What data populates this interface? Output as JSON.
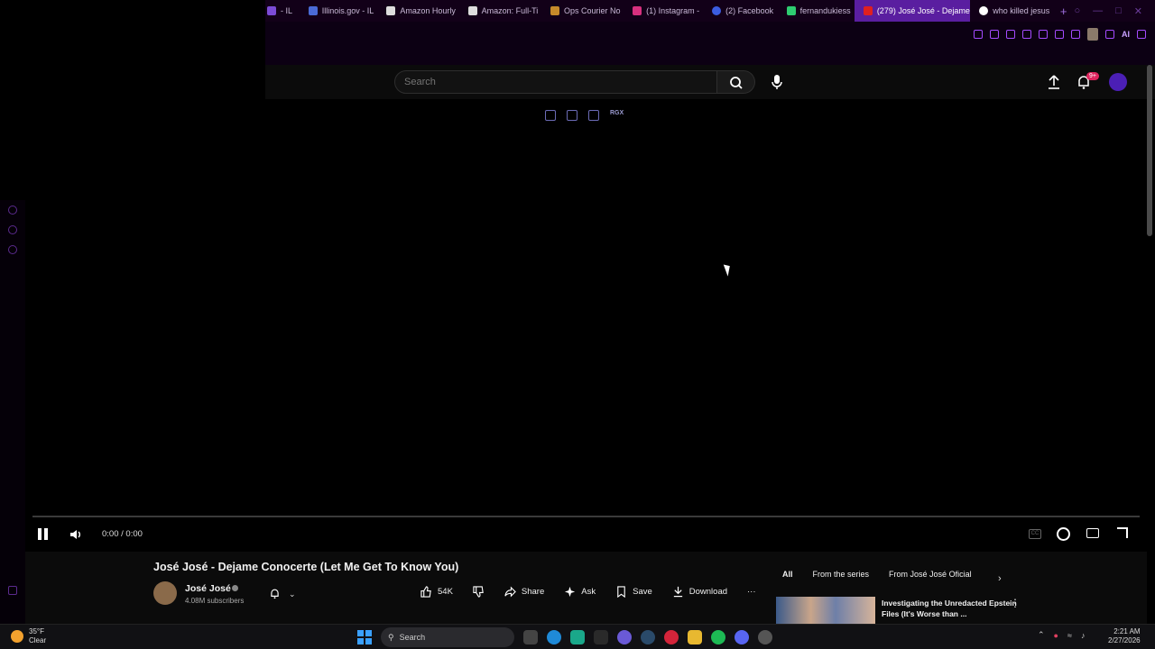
{
  "browser": {
    "tabs": [
      {
        "label": "- IL",
        "color": "#7b4bd6"
      },
      {
        "label": "Illinois.gov - IL",
        "color": "#4a6bd6"
      },
      {
        "label": "Amazon Hourly",
        "color": "#222222"
      },
      {
        "label": "Amazon: Full-Ti",
        "color": "#222222"
      },
      {
        "label": "Ops Courier No",
        "color": "#c58a2a"
      },
      {
        "label": "(1) Instagram -",
        "color": "#d6307e"
      },
      {
        "label": "(2) Facebook",
        "color": "#3b5de0"
      },
      {
        "label": "fernandukiess",
        "color": "#2ecc71"
      },
      {
        "label": "(279) José José - Dejame",
        "color": "#e02020",
        "active": true
      },
      {
        "label": "who killed jesus",
        "color": "#ffffff"
      }
    ],
    "new_tab": "+",
    "toolbar_ai_label": "AI"
  },
  "masthead": {
    "search_placeholder": "Search",
    "notification_count": "9+"
  },
  "player": {
    "mini_label": "RGX",
    "time": "0:00 / 0:00",
    "progress": 0
  },
  "video": {
    "title": "José José - Dejame Conocerte (Let Me Get To Know You)",
    "channel": "José José",
    "subscribers": "4.08M subscribers",
    "actions": {
      "likes": "54K",
      "share": "Share",
      "ask": "Ask",
      "save": "Save",
      "download": "Download",
      "more": "···"
    }
  },
  "related": {
    "chips": [
      "All",
      "From the series",
      "From José José Oficial"
    ],
    "first_title": "Investigating the Unredacted Epstein Files (It's Worse than ..."
  },
  "taskbar": {
    "weather_temp": "35°F",
    "weather_cond": "Clear",
    "search": "Search",
    "time": "2:21 AM",
    "date": "2/27/2026"
  }
}
